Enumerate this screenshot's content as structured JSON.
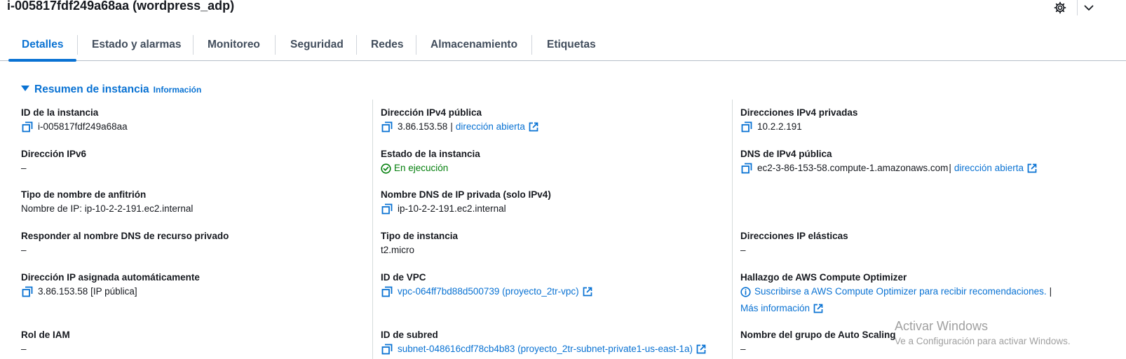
{
  "header": {
    "title": "i-005817fdf249a68aa (wordpress_adp)",
    "settings_icon": "gear-icon",
    "collapse_icon": "chevron-down-icon"
  },
  "tabs": [
    {
      "label": "Detalles",
      "active": true
    },
    {
      "label": "Estado y alarmas",
      "active": false
    },
    {
      "label": "Monitoreo",
      "active": false
    },
    {
      "label": "Seguridad",
      "active": false
    },
    {
      "label": "Redes",
      "active": false
    },
    {
      "label": "Almacenamiento",
      "active": false
    },
    {
      "label": "Etiquetas",
      "active": false
    }
  ],
  "section": {
    "title": "Resumen de instancia",
    "info_link": "Información"
  },
  "col1": {
    "instance_id": {
      "label": "ID de la instancia",
      "value": "i-005817fdf249a68aa"
    },
    "ipv6": {
      "label": "Dirección IPv6",
      "value": "–"
    },
    "hostname_type": {
      "label": "Tipo de nombre de anfitrión",
      "value": "Nombre de IP: ip-10-2-2-191.ec2.internal"
    },
    "private_dns_answer": {
      "label": "Responder al nombre DNS de recurso privado",
      "value": "–"
    },
    "auto_ip": {
      "label": "Dirección IP asignada automáticamente",
      "value": "3.86.153.58 [IP pública]"
    },
    "iam_role": {
      "label": "Rol de IAM",
      "value": "–"
    }
  },
  "col2": {
    "public_ipv4": {
      "label": "Dirección IPv4 pública",
      "value": "3.86.153.58",
      "separator": "|",
      "link": "dirección abierta"
    },
    "state": {
      "label": "Estado de la instancia",
      "value": "En ejecución"
    },
    "private_dns": {
      "label": "Nombre DNS de IP privada (solo IPv4)",
      "value": "ip-10-2-2-191.ec2.internal"
    },
    "instance_type": {
      "label": "Tipo de instancia",
      "value": "t2.micro"
    },
    "vpc_id": {
      "label": "ID de VPC",
      "value": "vpc-064ff7bd88d500739 (proyecto_2tr-vpc)"
    },
    "subnet_id": {
      "label": "ID de subred",
      "value": "subnet-048616cdf78cb4b83 (proyecto_2tr-subnet-private1-us-east-1a)"
    }
  },
  "col3": {
    "private_ipv4": {
      "label": "Direcciones IPv4 privadas",
      "value": "10.2.2.191"
    },
    "public_dns": {
      "label": "DNS de IPv4 pública",
      "value": "ec2-3-86-153-58.compute-1.amazonaws.com",
      "separator": "|",
      "link": "dirección abierta"
    },
    "elastic_ip": {
      "label": "Direcciones IP elásticas",
      "value": "–"
    },
    "optimizer": {
      "label": "Hallazgo de AWS Compute Optimizer",
      "value": "Suscribirse a AWS Compute Optimizer para recibir recomendaciones.",
      "separator": "|",
      "more_link": "Más información"
    },
    "asg": {
      "label": "Nombre del grupo de Auto Scaling",
      "value": "–"
    }
  },
  "watermark": {
    "line1": "Activar Windows",
    "line2": "Ve a Configuración para activar Windows."
  },
  "colors": {
    "accent": "#0972d3",
    "success": "#037f0c",
    "text": "#16191f",
    "tab_text": "#414d5c"
  }
}
